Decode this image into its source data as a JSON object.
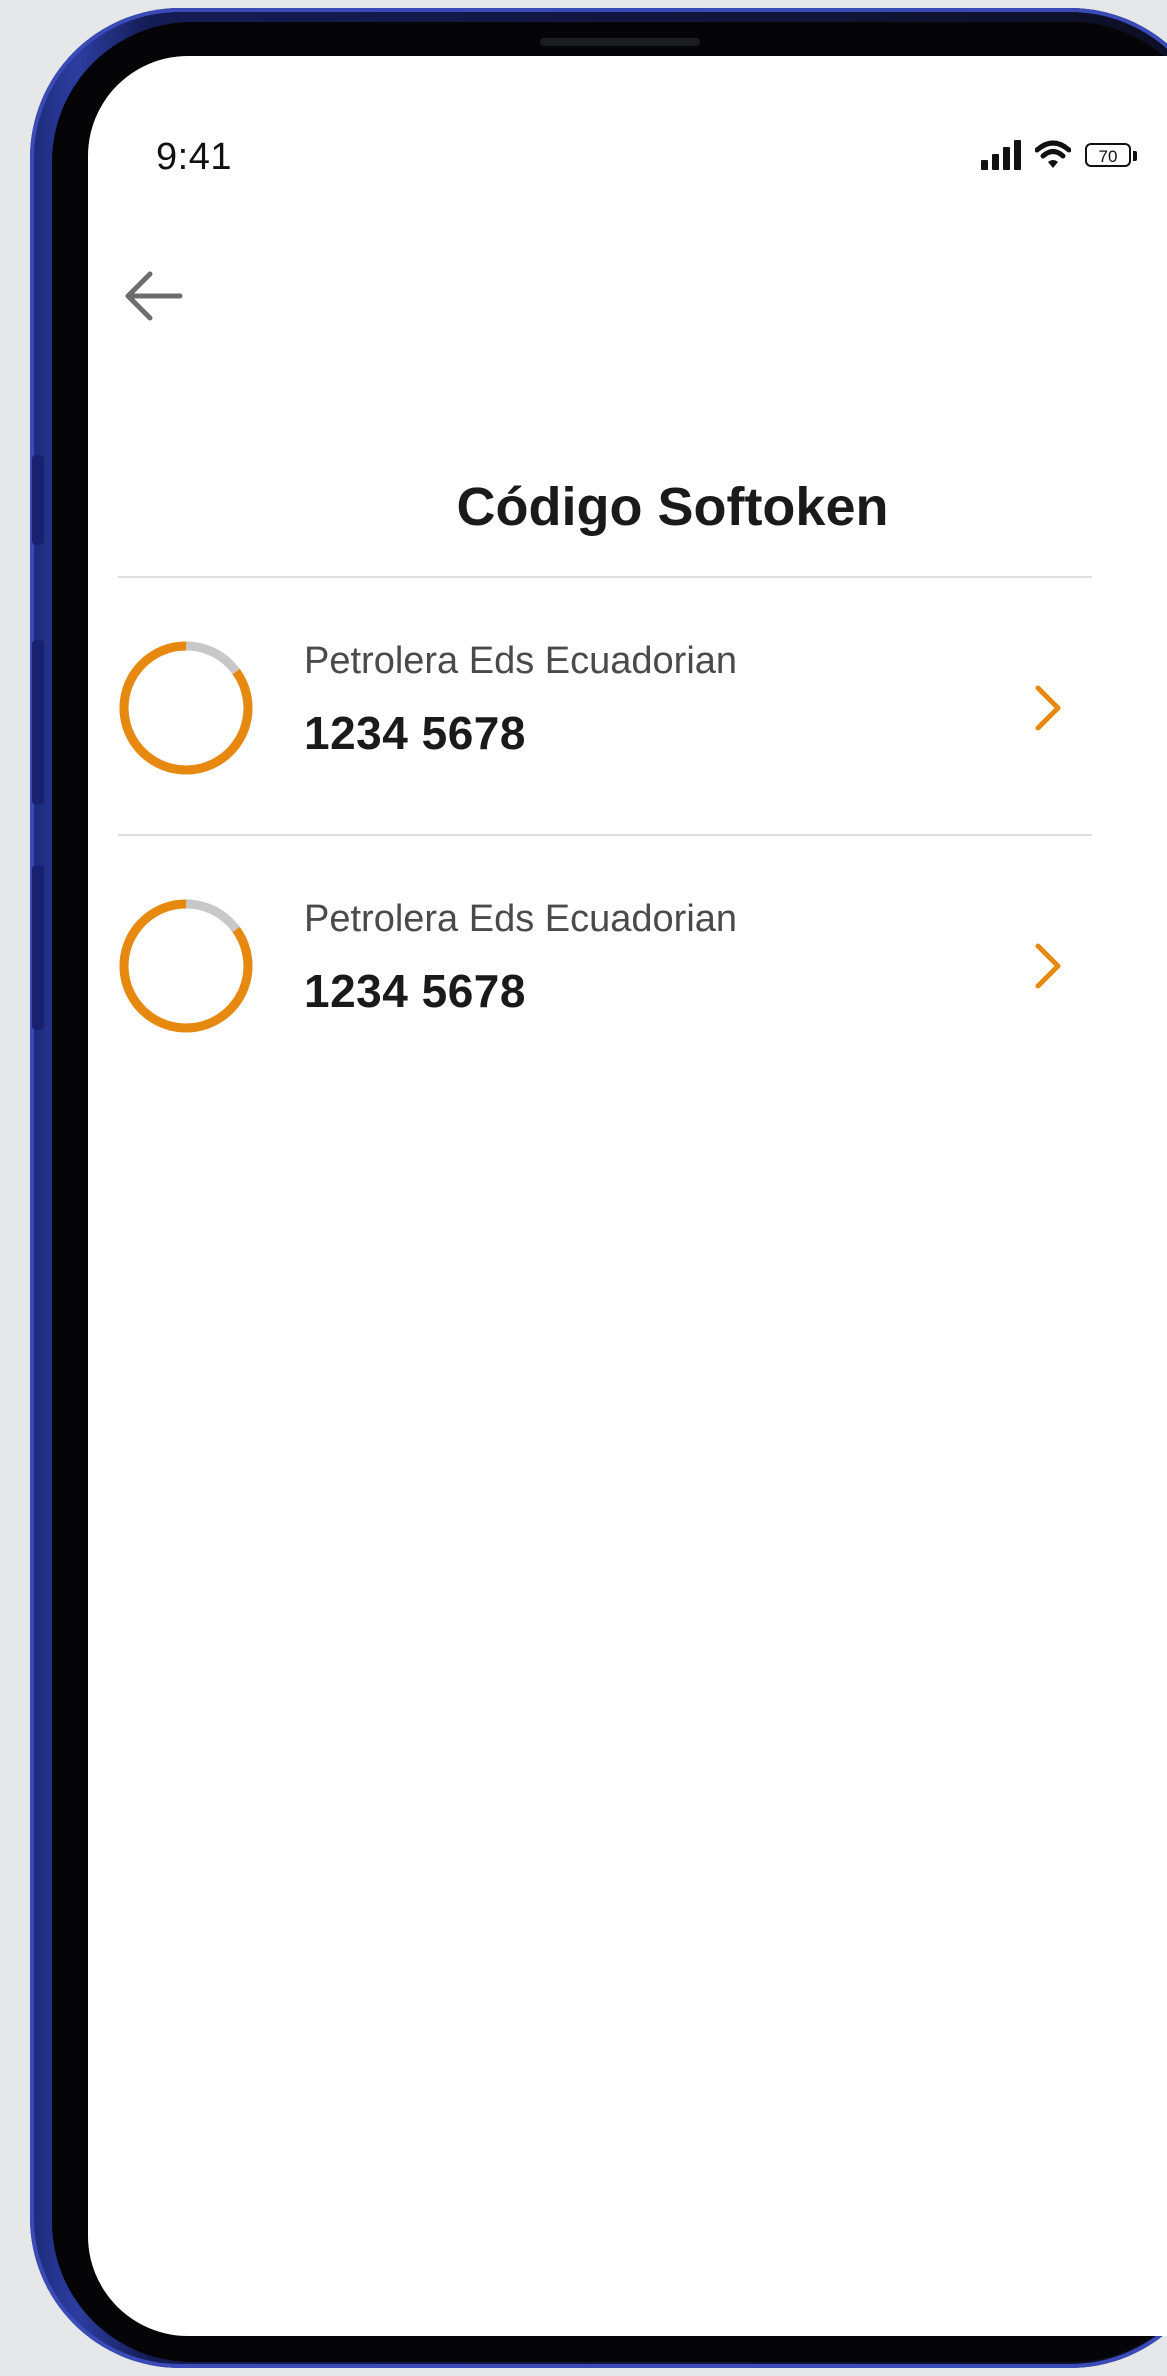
{
  "status_bar": {
    "time": "9:41",
    "battery_level": "70"
  },
  "page": {
    "title": "Código Softoken"
  },
  "tokens": [
    {
      "company": "Petrolera Eds Ecuadorian",
      "code": "1234 5678",
      "time_remaining_fraction": 0.85
    },
    {
      "company": "Petrolera Eds Ecuadorian",
      "code": "1234 5678",
      "time_remaining_fraction": 0.85
    }
  ],
  "colors": {
    "accent": "#e8890f",
    "ring_track": "#c8c8c8",
    "text": "#1a1a1a"
  }
}
